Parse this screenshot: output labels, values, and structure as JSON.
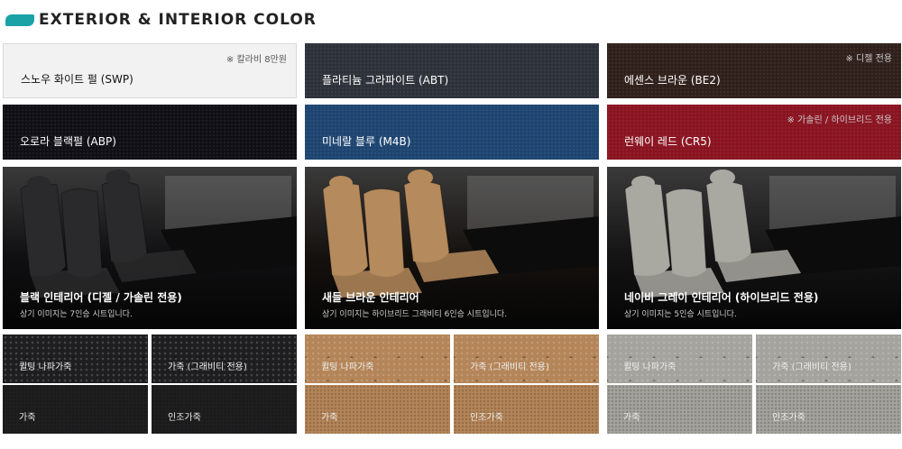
{
  "section_title": "EXTERIOR & INTERIOR COLOR",
  "exterior": [
    {
      "name": "스노우 화이트 펄 (SWP)",
      "note": "※ 칼라비 8만원",
      "color": "#f2f2f2"
    },
    {
      "name": "플라티늄 그라파이트 (ABT)",
      "note": "",
      "color": "#2c3038"
    },
    {
      "name": "에센스 브라운 (BE2)",
      "note": "※ 디젤 전용",
      "color": "#2f1f1a"
    },
    {
      "name": "오로라 블랙펄 (ABP)",
      "note": "",
      "color": "#0e0e14"
    },
    {
      "name": "미네랄 블루 (M4B)",
      "note": "",
      "color": "#1d4470"
    },
    {
      "name": "런웨이 레드 (CR5)",
      "note": "※ 가솔린 / 하이브리드 전용",
      "color": "#8a1320"
    }
  ],
  "interior": [
    {
      "name": "블랙 인테리어 (디젤 / 가솔린 전용)",
      "caption": "상기 이미지는 7인승 시트입니다.",
      "seat": "#2a2a2c",
      "bg": "#101012"
    },
    {
      "name": "새들 브라운 인테리어",
      "caption": "상기 이미지는 하이브리드 그래비티 6인승 시트입니다.",
      "seat": "#b58a5c",
      "bg": "#15110e"
    },
    {
      "name": "네이비 그레이 인테리어 (하이브리드 전용)",
      "caption": "상기 이미지는 5인승 시트입니다.",
      "seat": "#a9a8a1",
      "bg": "#141414"
    }
  ],
  "materials": [
    {
      "labels": [
        "퀼팅 나파가죽",
        "가죽 (그래비티 전용)",
        "가죽",
        "인조가죽"
      ],
      "color": "#1e1e20"
    },
    {
      "labels": [
        "퀼팅 나파가죽",
        "가죽 (그래비티 전용)",
        "가죽",
        "인조가죽"
      ],
      "color": "#b48558"
    },
    {
      "labels": [
        "퀼팅 나파가죽",
        "가죽 (그래비티 전용)",
        "가죽",
        "인조가죽"
      ],
      "color": "#a4a39d"
    }
  ]
}
